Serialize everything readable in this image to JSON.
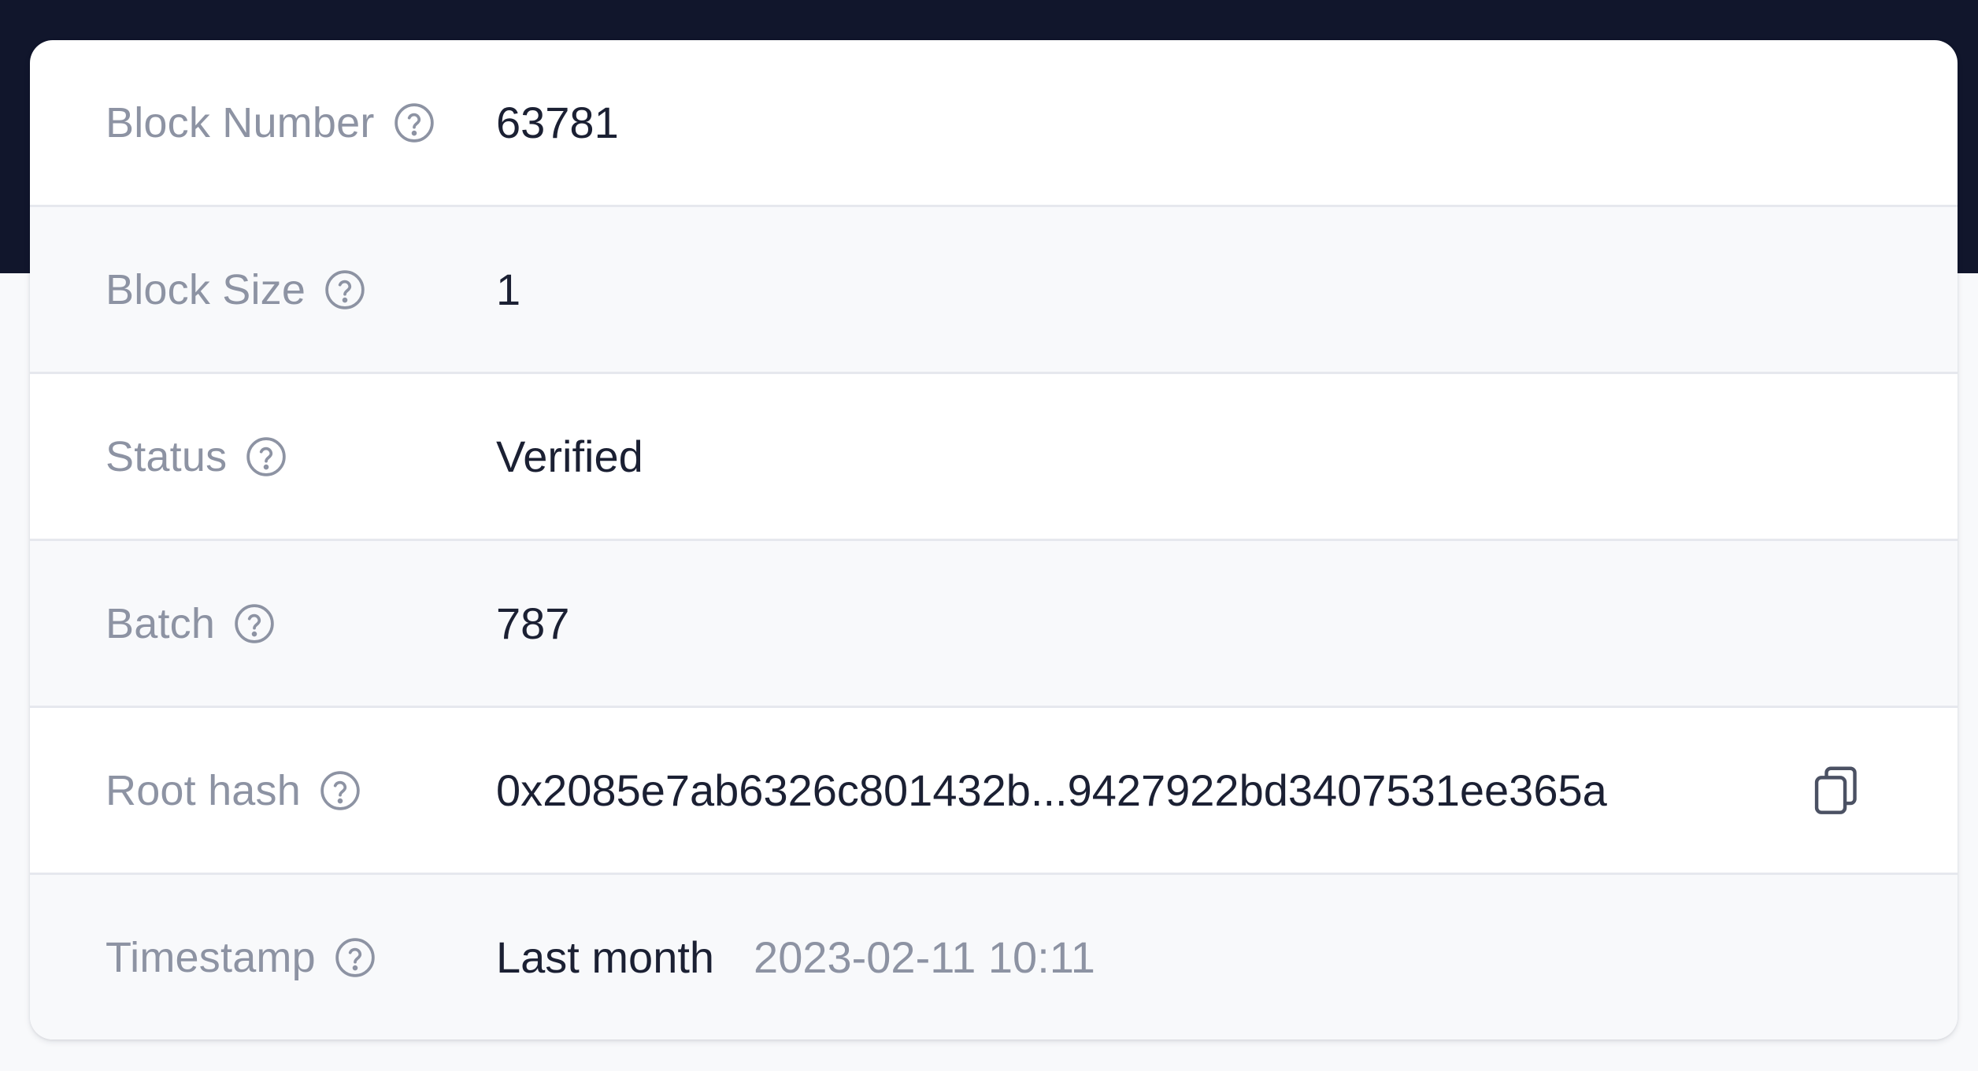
{
  "block_details": {
    "rows": [
      {
        "label": "Block Number",
        "value": "63781"
      },
      {
        "label": "Block Size",
        "value": "1"
      },
      {
        "label": "Status",
        "value": "Verified"
      },
      {
        "label": "Batch",
        "value": "787"
      },
      {
        "label": "Root hash",
        "value": "0x2085e7ab6326c801432b...9427922bd3407531ee365a"
      },
      {
        "label": "Timestamp",
        "value": "Last month",
        "secondary": "2023-02-11 10:11"
      }
    ]
  },
  "icons": {
    "help": "question-circle-icon",
    "copy": "copy-icon"
  },
  "colors": {
    "header_bg": "#11162c",
    "label": "#8d93a3",
    "value": "#1b2033",
    "row_alt": "#f8f9fb",
    "divider": "#e6e8ee"
  }
}
